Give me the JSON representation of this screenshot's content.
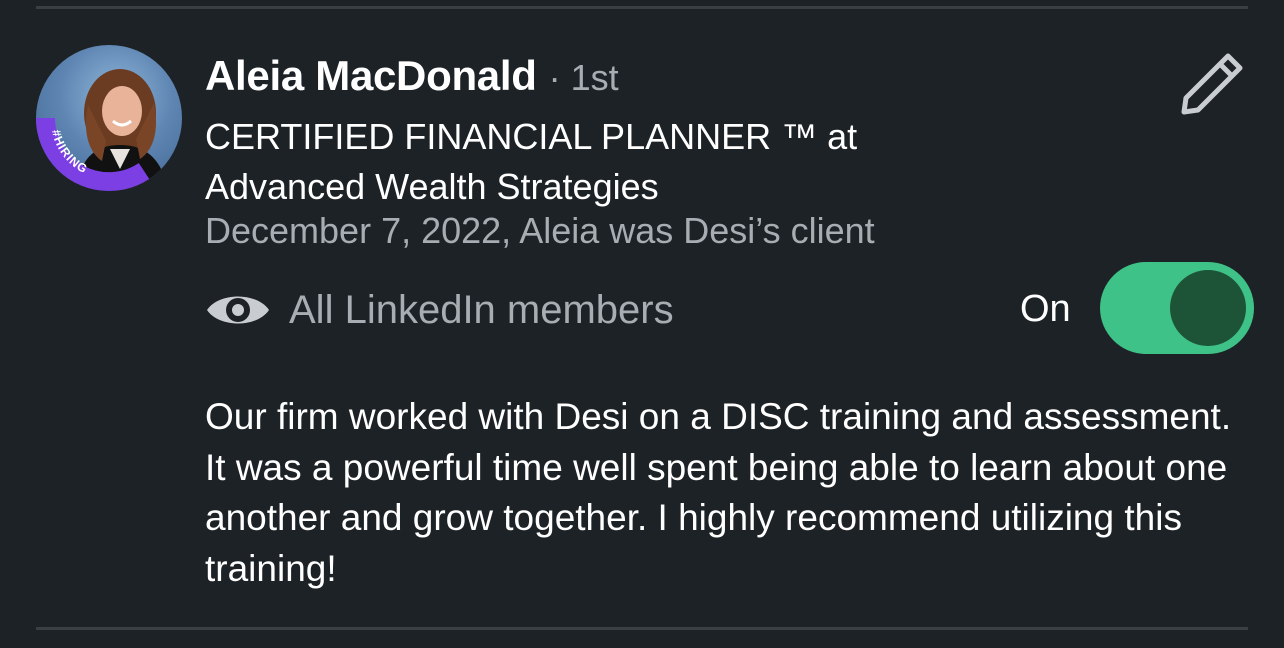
{
  "recommendation": {
    "name": "Aleia MacDonald",
    "degree": "· 1st",
    "headline_line1": "CERTIFIED FINANCIAL PLANNER ™ at",
    "headline_line2": "Advanced Wealth Strategies",
    "relation": "December 7, 2022, Aleia was Desi’s client",
    "avatar_badge": "#HIRING",
    "visibility": {
      "icon": "eye-icon",
      "label": "All LinkedIn members"
    },
    "toggle": {
      "label": "On",
      "state": true,
      "on_color": "#3ec287"
    },
    "text": "Our firm worked with Desi on a DISC training and assessment. It was a powerful time well spent being able to learn about one another and grow together. I highly recommend utilizing this training!"
  },
  "colors": {
    "background": "#1d2226",
    "primary_text": "#ffffff",
    "secondary_text": "#a7adb2",
    "hiring_ring": "#7b3fe4"
  }
}
